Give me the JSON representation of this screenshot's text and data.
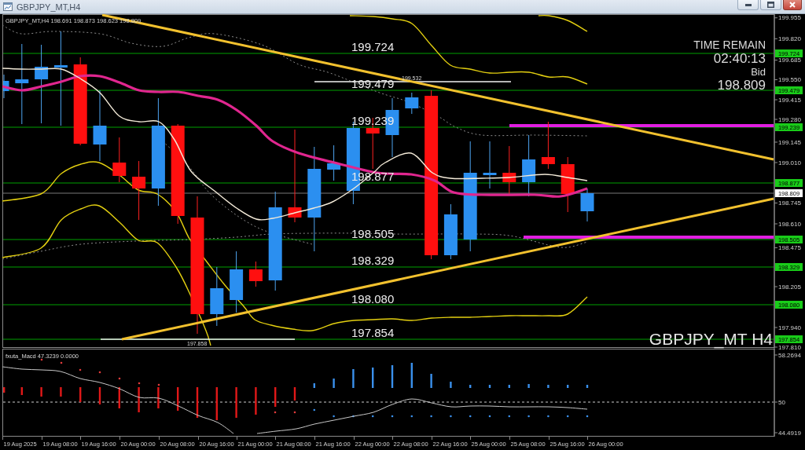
{
  "window": {
    "title": "GBPJPY_MT,H4"
  },
  "chart": {
    "header": "GBPJPY_MT,H4  198.691 198.873 198.623 198.809",
    "levels": [
      {
        "label": "199.724",
        "tag": "199.724"
      },
      {
        "label": "199.479",
        "tag": "199.479"
      },
      {
        "label": "199.239",
        "tag": "199.239"
      },
      {
        "label": "198.877",
        "tag": "198.877"
      },
      {
        "label": "198.505",
        "tag": "198.505"
      },
      {
        "label": "198.329",
        "tag": "198.329"
      },
      {
        "label": "198.080",
        "tag": "198.080"
      },
      {
        "label": "197.854",
        "tag": "197.854"
      }
    ],
    "swing_marks": [
      {
        "label": "199.532"
      },
      {
        "label": "197.858"
      }
    ],
    "timer": {
      "title": "TIME REMAIN",
      "time": "02:40:13",
      "bid_label": "Bid",
      "bid": "198.809"
    },
    "symbol_label": "GBPJPY_MT H4",
    "price_axis": {
      "ticks": [
        "199.955",
        "199.820",
        "199.685",
        "199.550",
        "199.415",
        "199.280",
        "199.145",
        "199.010",
        "198.745",
        "198.610",
        "198.475",
        "198.205",
        "197.940",
        "197.810"
      ],
      "bid_tag": "198.809"
    }
  },
  "indicator": {
    "header": "fxuta_Macd 47.3239  0.0000",
    "axis": [
      "58.2694",
      "50",
      "44.4919"
    ]
  },
  "time_axis": [
    "19 Aug 2025",
    "19 Aug 08:00",
    "19 Aug 16:00",
    "20 Aug 00:00",
    "20 Aug 08:00",
    "20 Aug 16:00",
    "21 Aug 00:00",
    "21 Aug 08:00",
    "21 Aug 16:00",
    "22 Aug 00:00",
    "22 Aug 08:00",
    "22 Aug 16:00",
    "25 Aug 00:00",
    "25 Aug 08:00",
    "25 Aug 16:00",
    "26 Aug 00:00"
  ]
}
